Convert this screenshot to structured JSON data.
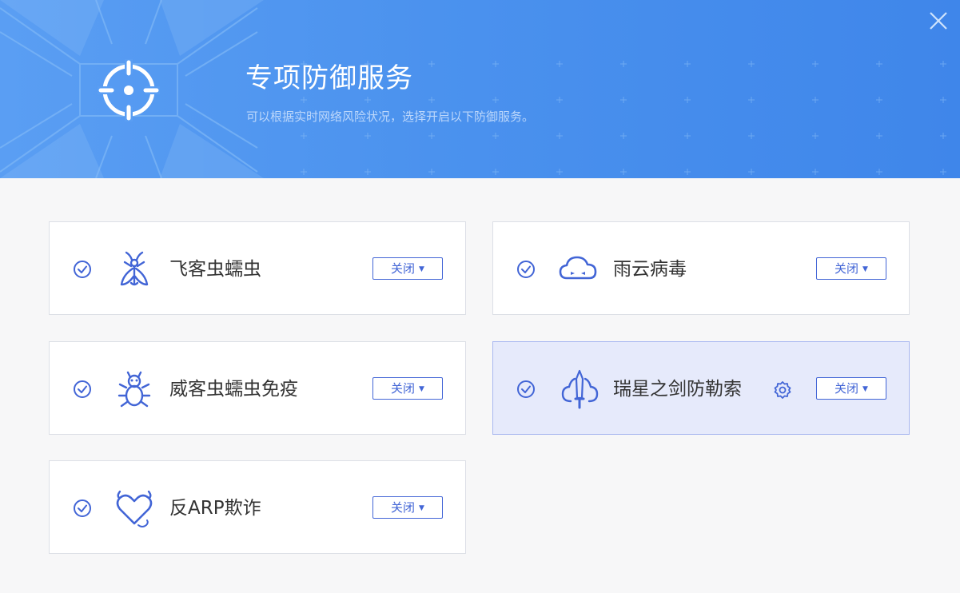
{
  "header": {
    "title": "专项防御服务",
    "subtitle": "可以根据实时网络风险状况，选择开启以下防御服务。",
    "close_icon": "close-icon",
    "logo_icon": "target-crosshair-icon"
  },
  "colors": {
    "header_blue": "#4b92ee",
    "accent": "#4265d6",
    "active_card_bg": "#e6eafb"
  },
  "services": [
    {
      "name": "飞客虫蠕虫",
      "icon": "firefly-bug-icon",
      "status": "关闭",
      "enabled": true
    },
    {
      "name": "雨云病毒",
      "icon": "cloud-virus-icon",
      "status": "关闭",
      "enabled": true
    },
    {
      "name": "威客虫蠕虫免疫",
      "icon": "shielded-bug-icon",
      "status": "关闭",
      "enabled": true
    },
    {
      "name": "瑞星之剑防勒索",
      "icon": "sword-cloud-icon",
      "status": "关闭",
      "enabled": true,
      "settings_icon": "gear-icon",
      "highlighted": true
    },
    {
      "name": "反ARP欺诈",
      "icon": "heart-lock-icon",
      "status": "关闭",
      "enabled": true
    }
  ]
}
